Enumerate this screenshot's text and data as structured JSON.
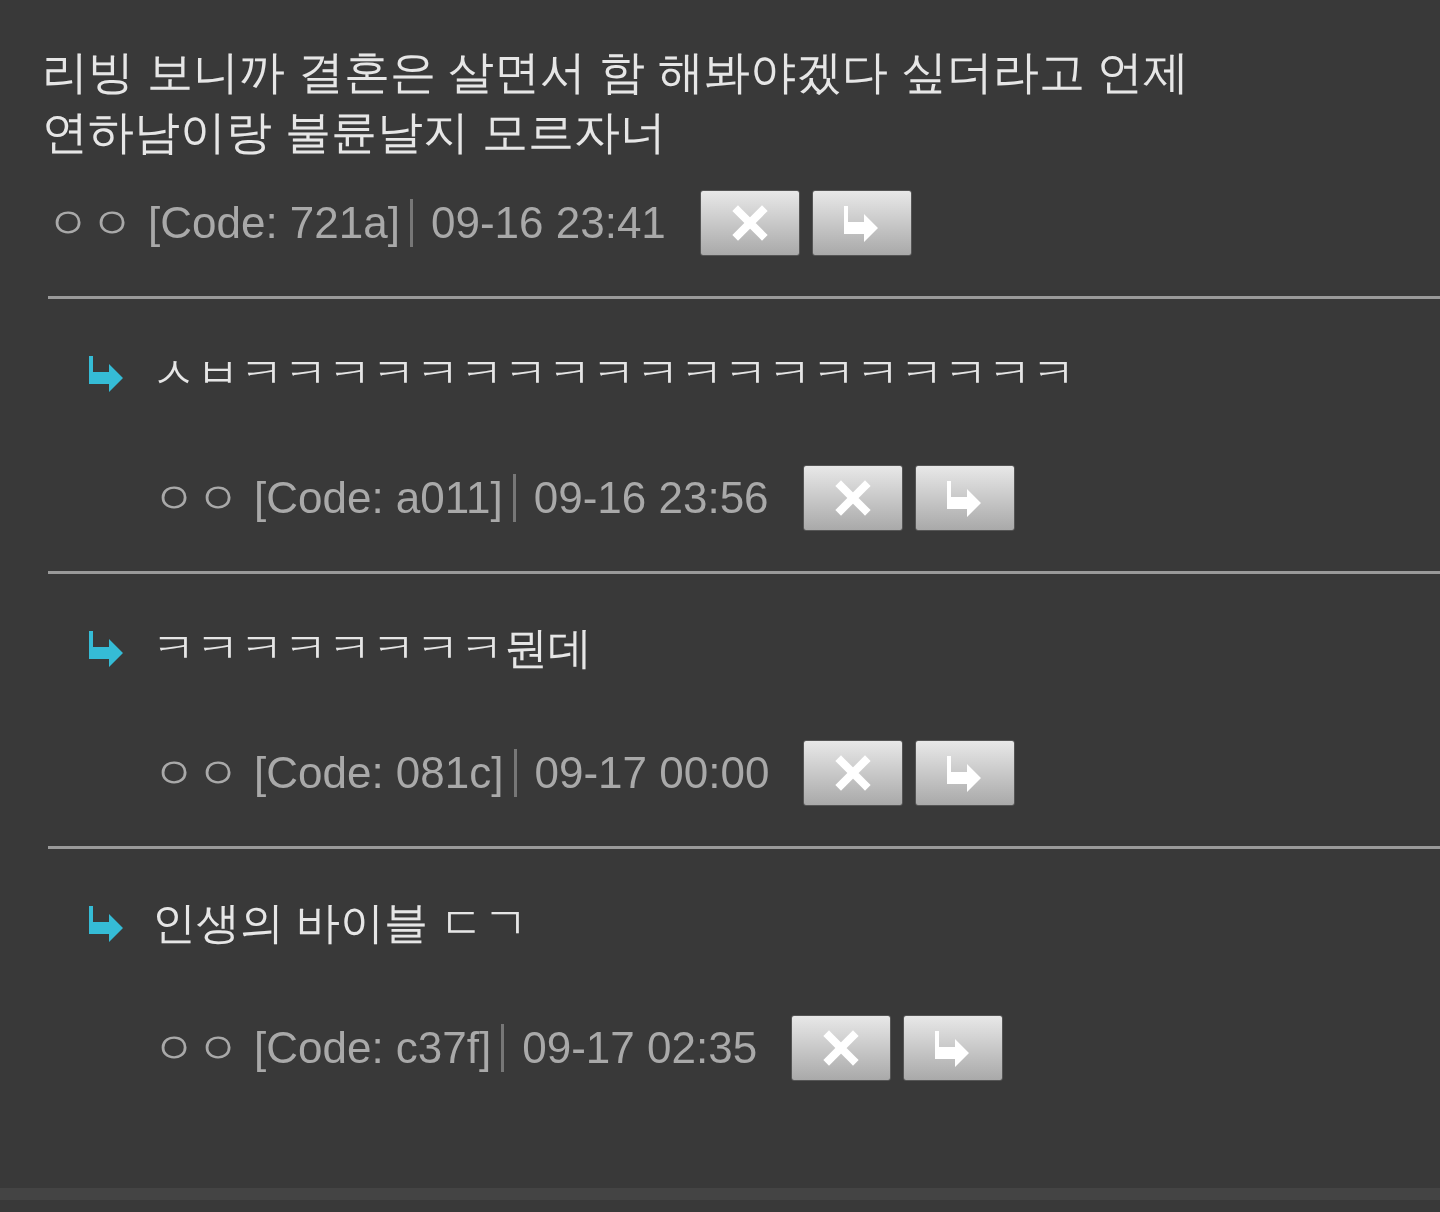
{
  "post": {
    "text": "리빙 보니까 결혼은 살면서 함 해봐야겠다 싶더라고 언제 연하남이랑 불륜날지 모르자너",
    "author": "ㅇㅇ",
    "code": "[Code: 721a]",
    "time": "09-16 23:41"
  },
  "replies": [
    {
      "text": "ㅅㅂㅋㅋㅋㅋㅋㅋㅋㅋㅋㅋㅋㅋㅋㅋㅋㅋㅋㅋㅋ",
      "author": "ㅇㅇ",
      "code": "[Code: a011]",
      "time": "09-16 23:56"
    },
    {
      "text": "ㅋㅋㅋㅋㅋㅋㅋㅋ뭔데",
      "author": "ㅇㅇ",
      "code": "[Code: 081c]",
      "time": "09-17 00:00"
    },
    {
      "text": "인생의 바이블 ㄷㄱ",
      "author": "ㅇㅇ",
      "code": "[Code: c37f]",
      "time": "09-17 02:35"
    }
  ]
}
